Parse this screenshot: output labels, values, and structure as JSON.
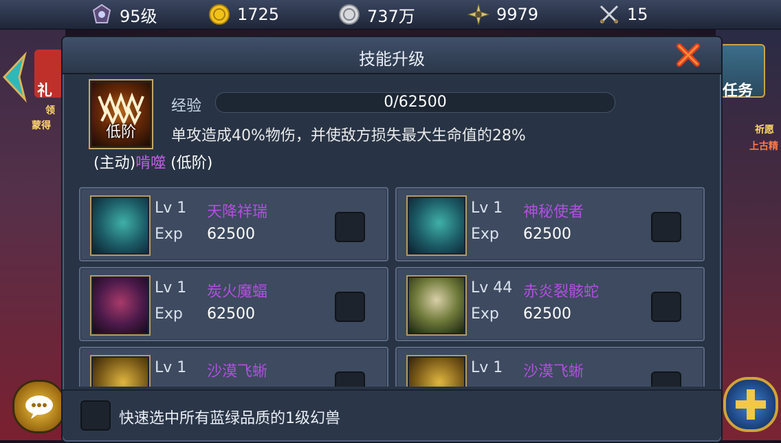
{
  "topbar": {
    "level": "95级",
    "gold": "1725",
    "silver": "737万",
    "power": "9979",
    "stamina": "15"
  },
  "side": {
    "left_gift_label": "礼",
    "left_claim_label": "领",
    "left_sub_label": "蒙得",
    "right_task_label": "任务",
    "right_wish_label": "祈愿",
    "right_sub_label": "上古精"
  },
  "dialog": {
    "title": "技能升级",
    "skill": {
      "grade": "低阶",
      "exp_label": "经验",
      "exp_value": "0/62500",
      "description": "单攻造成40%物伤，并使敌方损失最大生命值的28%",
      "type_prefix": "(主动)",
      "name": "啃噬",
      "grade_suffix": " (低阶)"
    },
    "cards": [
      {
        "lv": "Lv 1",
        "name": "天降祥瑞",
        "exp_label": "Exp",
        "exp": "62500",
        "portrait": "blue-bird"
      },
      {
        "lv": "Lv 1",
        "name": "神秘使者",
        "exp_label": "Exp",
        "exp": "62500",
        "portrait": "blue-bird"
      },
      {
        "lv": "Lv 1",
        "name": "炭火魔蝠",
        "exp_label": "Exp",
        "exp": "62500",
        "portrait": "red-bat"
      },
      {
        "lv": "Lv 44",
        "name": "赤炎裂骸蛇",
        "exp_label": "Exp",
        "exp": "62500",
        "portrait": "bone-serpent"
      },
      {
        "lv": "Lv 1",
        "name": "沙漠飞蜥",
        "exp_label": "Exp",
        "exp": "",
        "portrait": "gold-lizard"
      },
      {
        "lv": "Lv 1",
        "name": "沙漠飞蜥",
        "exp_label": "Exp",
        "exp": "",
        "portrait": "gold-lizard"
      }
    ],
    "bottom_label": "快速选中所有蓝绿品质的1级幻兽"
  },
  "colors": {
    "purple_name": "#b24fe0",
    "close_red": "#e2401c",
    "panel": "#283445"
  }
}
